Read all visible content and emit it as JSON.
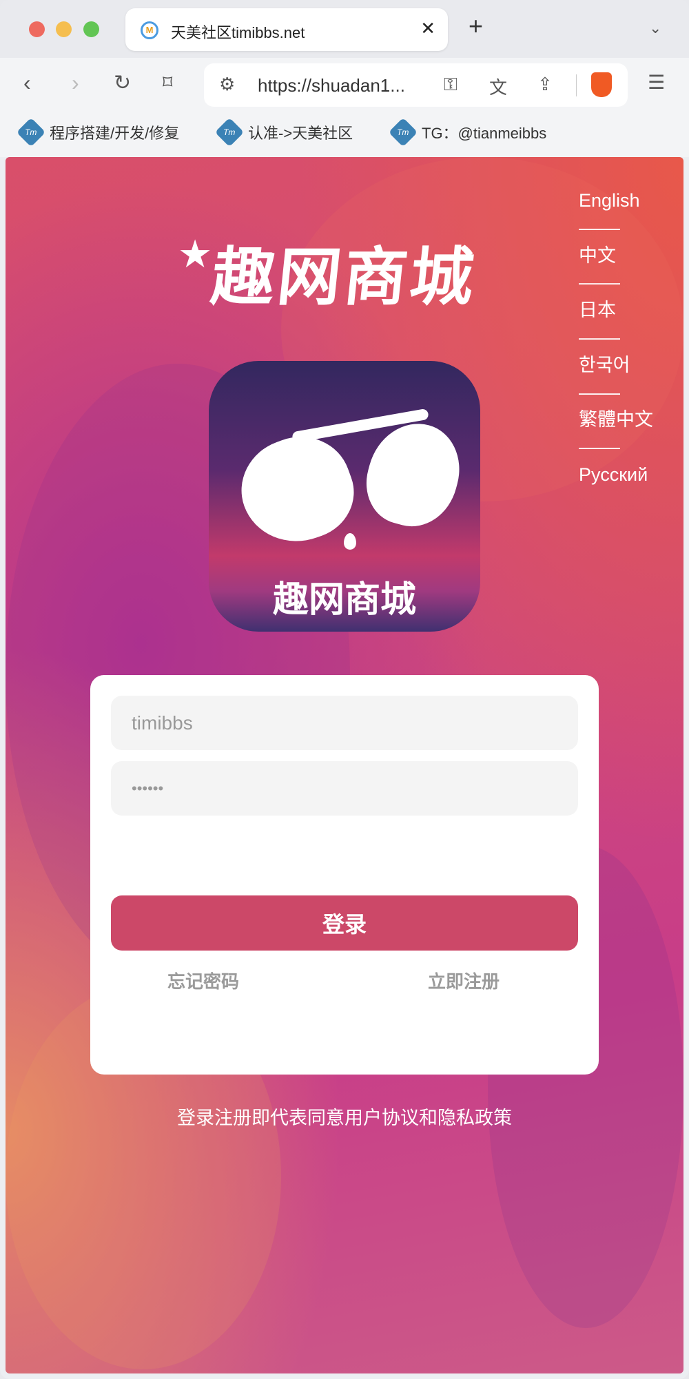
{
  "browser": {
    "tab_title": "天美社区timibbs.net",
    "url": "https://shuadan1...",
    "bookmarks": [
      {
        "label": "程序搭建/开发/修复",
        "icon": "Tm"
      },
      {
        "label": "认准->天美社区",
        "icon": "Tm"
      },
      {
        "label": "TG：@tianmeibbs",
        "icon": "Tm"
      }
    ]
  },
  "page": {
    "languages": [
      "English",
      "––––",
      "中文",
      "––––",
      "日本",
      "––––",
      "한국어",
      "––––",
      "繁體中文",
      "––––",
      "Русский"
    ],
    "brand_title": "趣网商城",
    "app_icon_label": "趣网商城",
    "username_placeholder": "timibbs",
    "password_placeholder": "••••••",
    "login_label": "登录",
    "forgot_label": "忘记密码",
    "register_label": "立即注册",
    "agreement": "登录注册即代表同意用户协议和隐私政策"
  },
  "colors": {
    "accent": "#cc4868"
  }
}
